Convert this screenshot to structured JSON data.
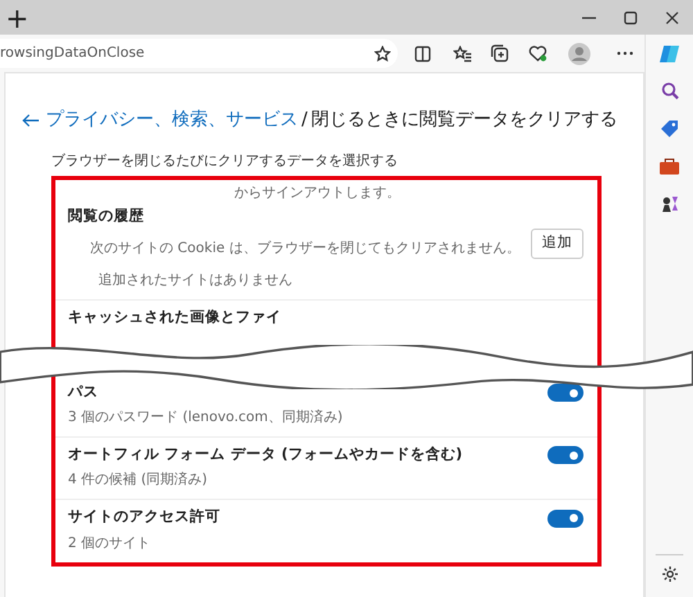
{
  "window": {
    "new_tab": "+"
  },
  "address_bar": {
    "url": "rowsingDataOnClose"
  },
  "breadcrumb": {
    "parent": "プライバシー、検索、サービス",
    "separator": "/",
    "current": "閉じるときに閲覧データをクリアする"
  },
  "subtitle": "ブラウザーを閉じるたびにクリアするデータを選択する",
  "group": {
    "highlighted": true,
    "sections": [
      {
        "kind": "history",
        "note": "からサインアウトします。",
        "title": "閲覧の履歴",
        "add_button": "追加",
        "description": "次のサイトの Cookie は、ブラウザーを閉じてもクリアされません。",
        "empty": "追加されたサイトはありません"
      },
      {
        "kind": "partial",
        "title": "キャッシュされた画像とファイ"
      },
      {
        "kind": "toggle",
        "title": "パス",
        "description": "3 個のパスワード (lenovo.com、同期済み)",
        "on": true
      },
      {
        "kind": "toggle",
        "title": "オートフィル フォーム データ (フォームやカードを含む)",
        "description": "4 件の候補 (同期済み)",
        "on": true
      },
      {
        "kind": "toggle",
        "title": "サイトのアクセス許可",
        "description": "2 個のサイト",
        "on": true
      }
    ]
  }
}
